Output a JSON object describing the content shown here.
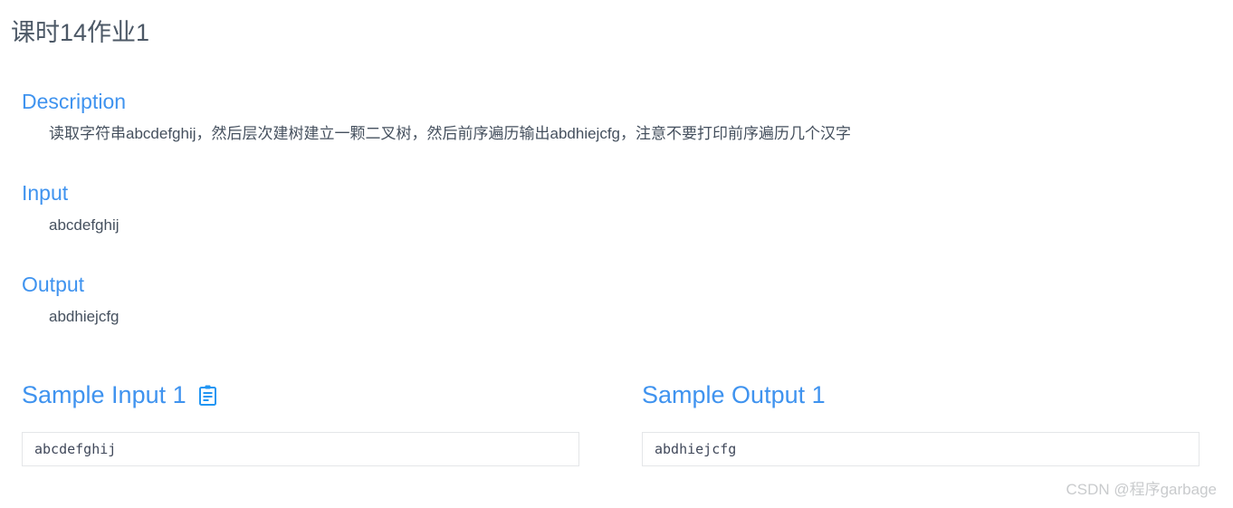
{
  "page": {
    "title": "课时14作业1",
    "title_color": "#4c5866",
    "accent_color": "#3f93ef",
    "body_text_color": "#45505e",
    "box_border_color": "#e4e6e8"
  },
  "sections": [
    {
      "key": "description",
      "heading": "Description",
      "body": "读取字符串abcdefghij，然后层次建树建立一颗二叉树，然后前序遍历输出abdhiejcfg，注意不要打印前序遍历几个汉字"
    },
    {
      "key": "input",
      "heading": "Input",
      "body": "abcdefghij"
    },
    {
      "key": "output",
      "heading": "Output",
      "body": "abdhiejcfg"
    }
  ],
  "samples": {
    "input": {
      "heading": "Sample Input 1",
      "copy_icon": "clipboard-copy-icon",
      "value": "abcdefghij"
    },
    "output": {
      "heading": "Sample Output 1",
      "value": "abdhiejcfg"
    }
  },
  "watermark": {
    "text": "CSDN @程序garbage"
  }
}
